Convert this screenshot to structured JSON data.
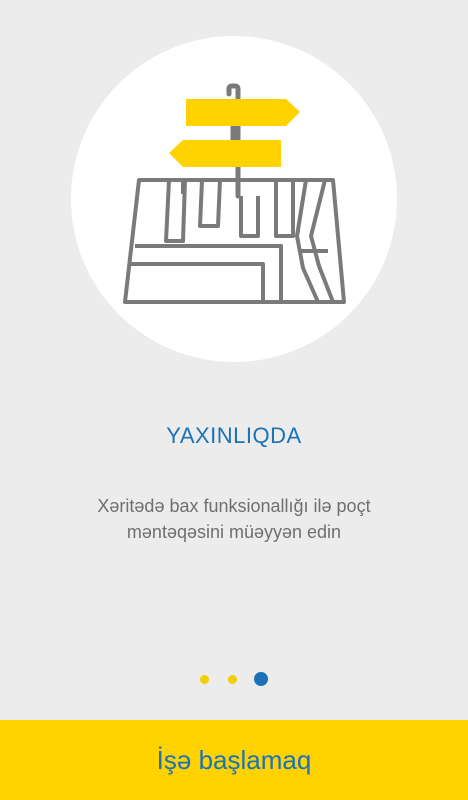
{
  "onboarding": {
    "illustration_icon": "map-signpost-icon",
    "title": "YAXINLIQDA",
    "description_line1": "Xəritədə bax funksionallığı ilə poçt",
    "description_line2": "məntəqəsini müəyyən edin",
    "pager": {
      "page_count": 3,
      "active_index": 2
    },
    "start_button_label": "İşə başlamaq"
  },
  "colors": {
    "background": "#ececec",
    "circle": "#ffffff",
    "accent_yellow": "#ffd200",
    "accent_blue": "#1a73b8",
    "text_gray": "#6f6f6f",
    "map_gray": "#7a7a7a"
  }
}
